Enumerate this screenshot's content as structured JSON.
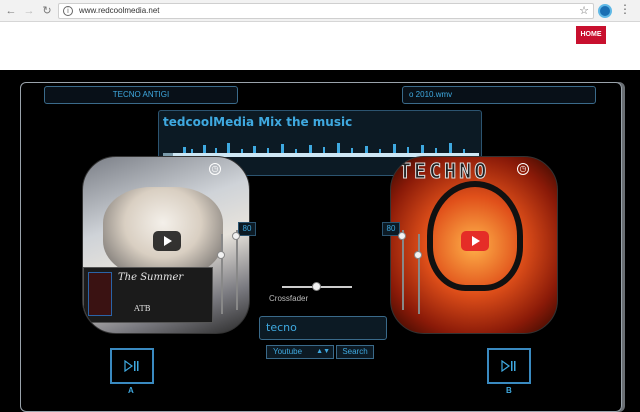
{
  "browser": {
    "url": "www.redcoolmedia.net"
  },
  "header": {
    "home_label": "HOME"
  },
  "deck_a": {
    "title": "TECNO ANTIGI",
    "cover_title": "The Summer",
    "cover_artist": "ATB",
    "volume_label": "80",
    "deck_label": "A"
  },
  "deck_b": {
    "title": "o 2010.wmv",
    "art_text": "TECHNO",
    "volume_label": "80",
    "deck_label": "B"
  },
  "banner": {
    "title": "tedcoolMedia Mix the music"
  },
  "crossfader": {
    "label": "Crossfader",
    "position": 0.5
  },
  "search": {
    "query": "tecno",
    "source_selected": "Youtube",
    "button_label": "Search"
  },
  "colors": {
    "accent": "#3fa9e0",
    "home_bg": "#c8102e"
  }
}
